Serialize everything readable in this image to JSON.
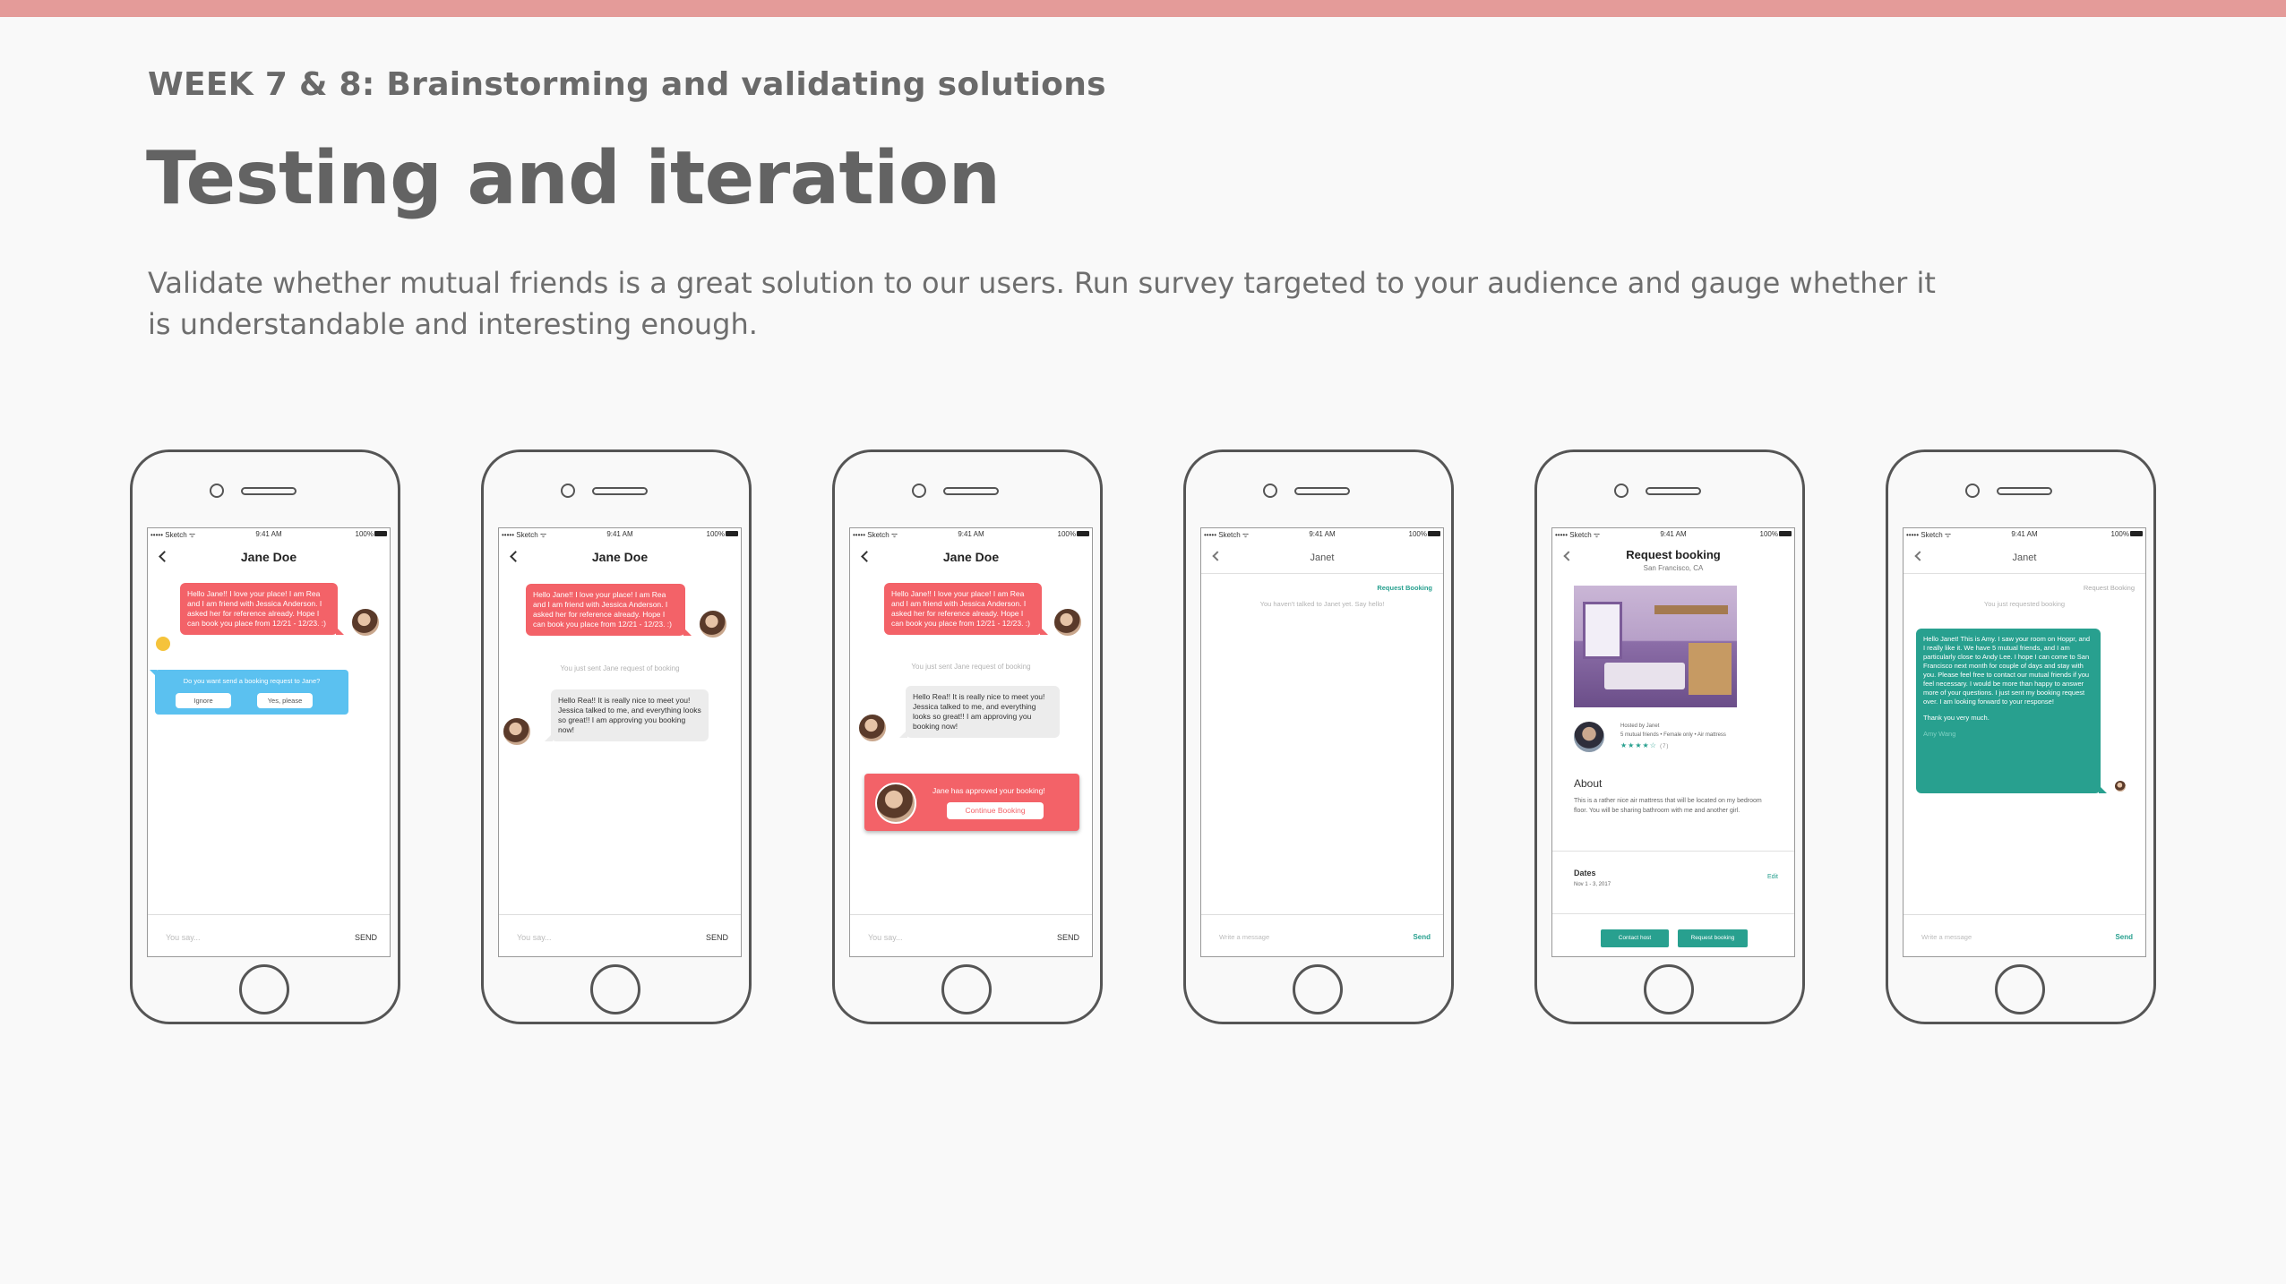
{
  "slide": {
    "week": "WEEK 7 & 8: Brainstorming and validating solutions",
    "title": "Testing and iteration",
    "description": "Validate whether mutual friends is a great solution to our users. Run survey targeted to your audience and gauge whether it is understandable and interesting enough."
  },
  "colors": {
    "accent_bar": "#e49b99",
    "bubble_red": "#f36268",
    "bubble_blue": "#5bc1f0",
    "teal": "#28a08f"
  },
  "status": {
    "carrier": "••••• Sketch ᯤ",
    "time": "9:41 AM",
    "battery": "100%"
  },
  "phone1": {
    "header": "Jane Doe",
    "message": "Hello Jane!! I love your place! I am Rea and I am friend with Jessica Anderson. I asked her for reference already. Hope I can book you place from 12/21 - 12/23. :)",
    "prompt": "Do you want send a booking request to Jane?",
    "ignore": "Ignore",
    "yes": "Yes, please",
    "placeholder": "You say...",
    "send": "SEND"
  },
  "phone2": {
    "header": "Jane Doe",
    "message": "Hello Jane!! I love your place! I am Rea and I am friend with Jessica Anderson. I asked her for reference already. Hope I can book you place from 12/21 - 12/23. :)",
    "note": "You just sent Jane request of booking",
    "reply": "Hello Rea!! It is really nice to meet you! Jessica talked to me, and everything looks so great!! I am approving you booking now!",
    "placeholder": "You say...",
    "send": "SEND"
  },
  "phone3": {
    "header": "Jane Doe",
    "message": "Hello Jane!! I love your place! I am Rea and I am friend with Jessica Anderson. I asked her for reference already. Hope I can book you place from 12/21 - 12/23. :)",
    "note": "You just sent Jane request of booking",
    "reply": "Hello Rea!! It is really nice to meet you! Jessica talked to me, and everything looks so great!! I am approving you booking now!",
    "approved": "Jane has approved your booking!",
    "continue": "Continue Booking",
    "placeholder": "You say...",
    "send": "SEND"
  },
  "phone4": {
    "header": "Janet",
    "request_link": "Request Booking",
    "note": "You haven't talked to Janet yet. Say hello!",
    "placeholder": "Write a message",
    "send": "Send"
  },
  "phone5": {
    "header": "Request booking",
    "location": "San Francisco, CA",
    "hosted": "Hosted by Janet",
    "meta": "5 mutual friends • Female only • Air mattress",
    "stars": "★★★★☆",
    "rating_count": "(7)",
    "about_title": "About",
    "about_text": "This is a rather nice air mattress that will be located on my bedroom floor. You will be sharing bathroom with me and another girl.",
    "dates_title": "Dates",
    "dates_value": "Nov 1 - 3, 2017",
    "edit": "Edit",
    "contact": "Contact host",
    "request": "Request booking"
  },
  "phone6": {
    "header": "Janet",
    "request_link": "Request Booking",
    "note": "You just requested booking",
    "message": "Hello Janet! This is Amy. I saw your room on Hoppr, and I really like it. We have 5 mutual friends, and I am particularly close to Andy Lee. I hope I can come to San Francisco next month for couple of days and stay with you. Please feel free to contact our mutual friends if you feel necessary. I would be more than happy to answer more of your questions. I just sent my booking request over. I am looking forward to your response!",
    "thanks": "Thank you very much.",
    "signature": "Amy Wang",
    "placeholder": "Write a message",
    "send": "Send"
  }
}
